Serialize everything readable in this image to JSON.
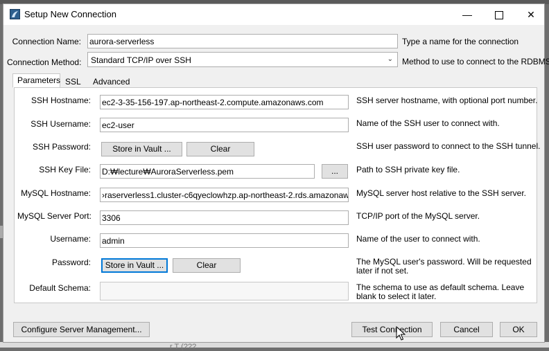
{
  "window": {
    "title": "Setup New Connection"
  },
  "form": {
    "connection_name": {
      "label": "Connection Name:",
      "value": "aurora-serverless",
      "desc": "Type a name for the connection"
    },
    "connection_method": {
      "label": "Connection Method:",
      "value": "Standard TCP/IP over SSH",
      "desc": "Method to use to connect to the RDBMS"
    }
  },
  "tabs": [
    "Parameters",
    "SSL",
    "Advanced"
  ],
  "params": {
    "ssh_hostname": {
      "label": "SSH Hostname:",
      "value": "ec2-3-35-156-197.ap-northeast-2.compute.amazonaws.com",
      "desc": "SSH server hostname, with  optional port number."
    },
    "ssh_username": {
      "label": "SSH Username:",
      "value": "ec2-user",
      "desc": "Name of the SSH user to connect with."
    },
    "ssh_password": {
      "label": "SSH Password:",
      "store_label": "Store in Vault ...",
      "clear_label": "Clear",
      "desc": "SSH user password to connect to the SSH tunnel."
    },
    "ssh_key_file": {
      "label": "SSH Key File:",
      "value": "D:₩lecture₩AuroraServerless.pem",
      "browse_label": "...",
      "desc": "Path to SSH private key file."
    },
    "mysql_hostname": {
      "label": "MySQL Hostname:",
      "value": "›raserverless1.cluster-c6qyeclowhzp.ap-northeast-2.rds.amazonaws.com",
      "desc": "MySQL server host relative to the SSH server."
    },
    "mysql_port": {
      "label": "MySQL Server Port:",
      "value": "3306",
      "desc": "TCP/IP port of the MySQL server."
    },
    "username": {
      "label": "Username:",
      "value": "admin",
      "desc": "Name of the user to connect with."
    },
    "password": {
      "label": "Password:",
      "store_label": "Store in Vault ...",
      "clear_label": "Clear",
      "desc_line1": "The MySQL user's password. Will be requested",
      "desc_line2": "later if not set."
    },
    "default_schema": {
      "label": "Default Schema:",
      "value": "",
      "desc_line1": "The schema to use as default schema. Leave",
      "desc_line2": "blank to select it later."
    }
  },
  "footer": {
    "configure_label": "Configure Server Management...",
    "test_label": "Test Connection",
    "cancel_label": "Cancel",
    "ok_label": "OK"
  },
  "background": {
    "partial_text": "r  T (???"
  }
}
